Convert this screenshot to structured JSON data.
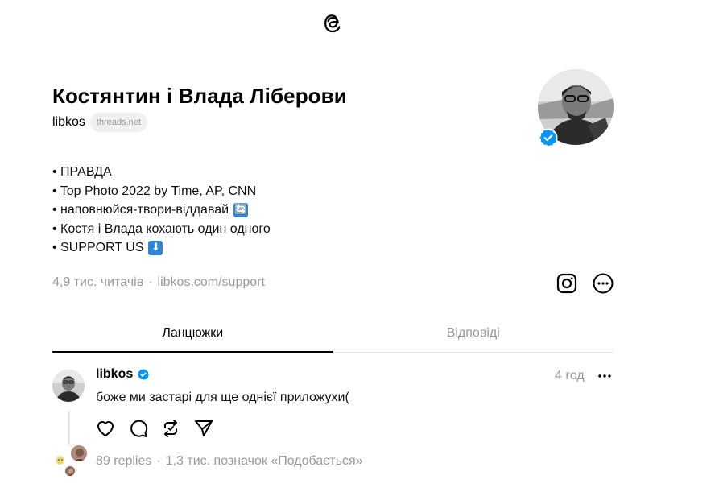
{
  "header": {
    "logo_icon": "threads-logo-icon"
  },
  "profile": {
    "name": "Костянтин і Влада Ліберови",
    "handle": "libkos",
    "domain": "threads.net",
    "verified": true,
    "bio": [
      {
        "text": "• ПРАВДА",
        "emoji": ""
      },
      {
        "text": "• Top Photo 2022 by Time, AP, CNN",
        "emoji": ""
      },
      {
        "text": "• наповнюйся-твори-віддавай",
        "emoji": "🔄"
      },
      {
        "text": "• Костя і Влада кохають один одного",
        "emoji": ""
      },
      {
        "text": "• SUPPORT US",
        "emoji": "⬇"
      }
    ],
    "followers": "4,9 тис. читачів",
    "separator": "·",
    "link": "libkos.com/support"
  },
  "actions": {
    "instagram_icon": "instagram-icon",
    "more_icon": "more-circle-icon"
  },
  "tabs": [
    {
      "label": "Ланцюжки",
      "active": true
    },
    {
      "label": "Відповіді",
      "active": false
    }
  ],
  "post": {
    "username": "libkos",
    "verified": true,
    "time": "4 год",
    "text": "боже ми застарі для ще однієї приложухи(",
    "replies": "89 replies",
    "separator": "·",
    "likes": "1,3 тис. позначок «Подобається»"
  },
  "colors": {
    "verified": "#0095f6",
    "muted": "#999999",
    "emoji_bg": "#2f86d6"
  }
}
